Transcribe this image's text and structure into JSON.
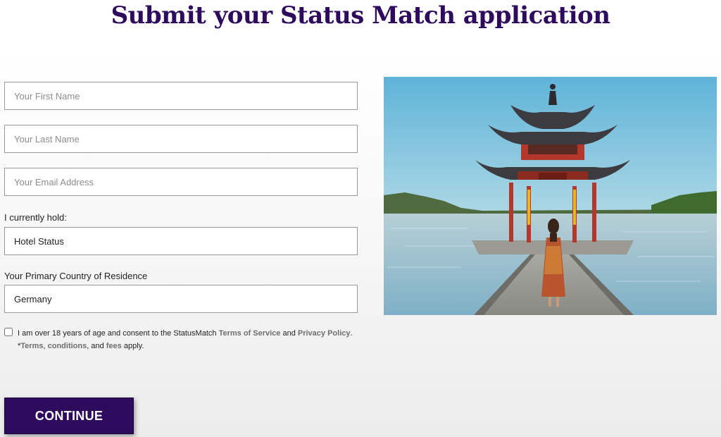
{
  "page": {
    "title": "Submit your Status Match application"
  },
  "form": {
    "first_name_placeholder": "Your First Name",
    "last_name_placeholder": "Your Last Name",
    "email_placeholder": "Your Email Address",
    "hold_label": "I currently hold:",
    "hold_value": "Hotel Status",
    "country_label": "Your Primary Country of Residence",
    "country_value": "Germany",
    "consent": {
      "checked": false,
      "text_1": "I am over 18 years of age and consent to the StatusMatch ",
      "terms_link": "Terms of Service",
      "text_and": " and ",
      "privacy_link": "Privacy Policy",
      "text_period": ".",
      "asterisk": "*",
      "terms_link_2": "Terms",
      "comma": ", ",
      "conditions_link": "conditions",
      "and_2": ", and ",
      "fees_link": "fees",
      "apply": " apply."
    },
    "continue_label": "CONTINUE"
  },
  "colors": {
    "brand_purple": "#2e0b5c",
    "link_gray": "#6e6e6e"
  },
  "image": {
    "subject": "Chinese pagoda pavilion on a pier over a lake with a woman walking"
  }
}
